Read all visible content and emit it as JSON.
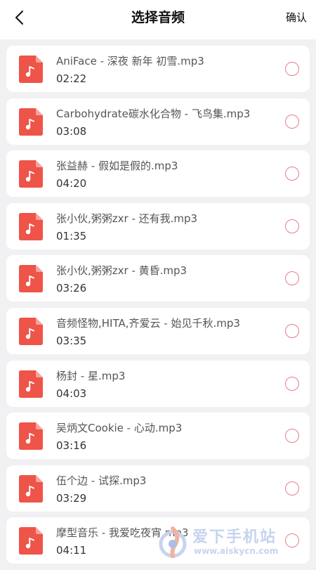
{
  "header": {
    "title": "选择音频",
    "confirm_label": "确认"
  },
  "colors": {
    "accent": "#ee5448",
    "radio_border": "#e87d8a",
    "background": "#f1f1f3"
  },
  "icons": {
    "back": "chevron-left-icon",
    "file": "music-file-icon",
    "radio": "radio-unchecked-icon"
  },
  "items": [
    {
      "name": "AniFace - 深夜 新年 初雪.mp3",
      "duration": "02:22"
    },
    {
      "name": "Carbohydrate碳水化合物 - 飞鸟集.mp3",
      "duration": "03:08"
    },
    {
      "name": "张益赫 - 假如是假的.mp3",
      "duration": "04:20"
    },
    {
      "name": "张小伙,粥粥zxr - 还有我.mp3",
      "duration": "01:35"
    },
    {
      "name": "张小伙,粥粥zxr - 黄昏.mp3",
      "duration": "03:26"
    },
    {
      "name": "音频怪物,HITA,齐爱云 - 始见千秋.mp3",
      "duration": "03:35"
    },
    {
      "name": "杨封 - 星.mp3",
      "duration": "04:03"
    },
    {
      "name": "吴炳文Cookie - 心动.mp3",
      "duration": "03:16"
    },
    {
      "name": "伍个边 - 试探.mp3",
      "duration": "03:29"
    },
    {
      "name": "摩型音乐 - 我爱吃夜宵.mp3",
      "duration": "04:11"
    }
  ],
  "watermark": {
    "title": "爱下手机站",
    "url": "www.aiskycn.com"
  }
}
